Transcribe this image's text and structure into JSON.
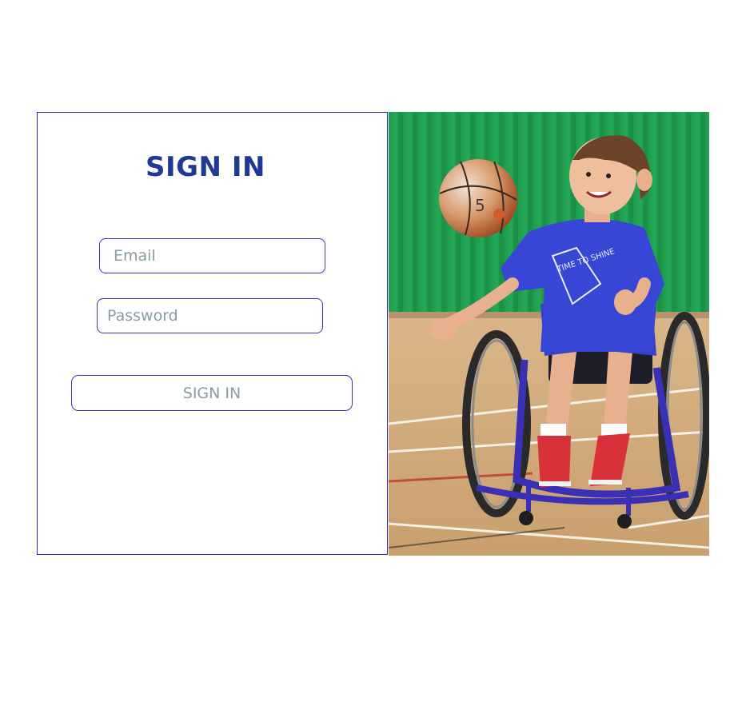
{
  "signin": {
    "title": "SIGN IN",
    "email_placeholder": "Email",
    "password_placeholder": "Password",
    "button_label": "SIGN IN"
  },
  "photo": {
    "shirt_text": "TIME TO SHINE",
    "ball_number": "5"
  },
  "colors": {
    "accent": "#1f3a93",
    "border": "#3a36b0",
    "placeholder": "#8a9ba3"
  }
}
